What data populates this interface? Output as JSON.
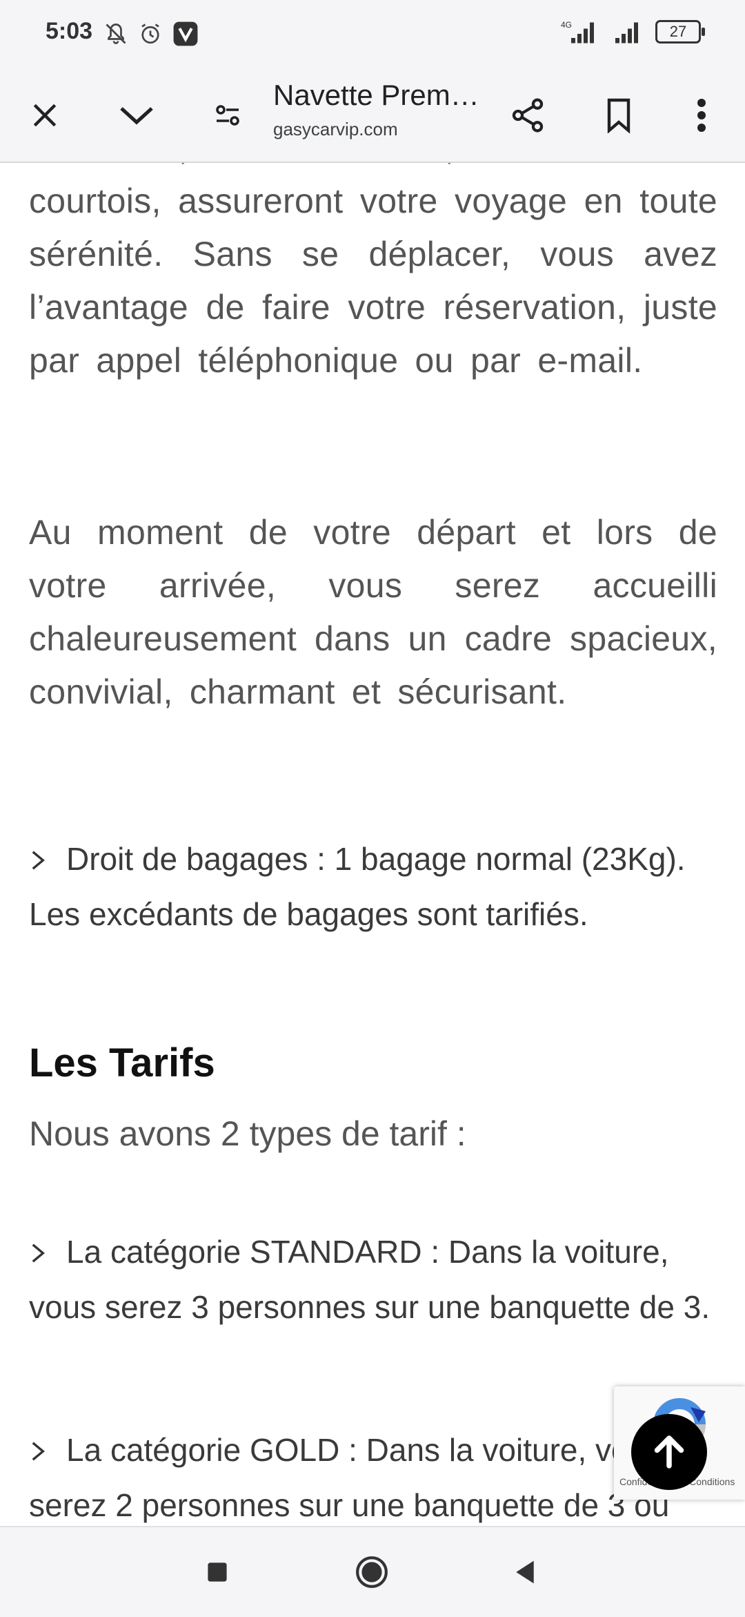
{
  "status": {
    "time": "5:03",
    "network": "4G",
    "battery": "27"
  },
  "toolbar": {
    "title": "Navette Prem…",
    "url": "gasycarvip.com"
  },
  "content": {
    "para1": "défensive, mais encore, serviables et courtois, assureront votre voyage en toute sérénité. Sans se déplacer, vous avez l’avantage de faire votre réservation, juste par appel téléphonique ou par e-mail.",
    "para2": "Au moment de votre départ et lors de votre arrivée, vous serez accueilli chaleureusement dans un cadre spacieux, convivial, charmant et sécurisant.",
    "bullet_bagages": "Droit de bagages : 1 bagage normal (23Kg). Les excédants de bagages sont tarifiés.",
    "tarifs_heading": "Les Tarifs",
    "tarifs_intro": "Nous avons 2 types de tarif :",
    "bullet_standard": "La catégorie STANDARD : Dans la voiture, vous serez 3 personnes sur une banquette de 3.",
    "bullet_gold": "La catégorie GOLD : Dans la voiture, vous serez 2 personnes sur une banquette de 3 ou"
  },
  "recaptcha": {
    "text": "Confidentialité - Conditions"
  }
}
